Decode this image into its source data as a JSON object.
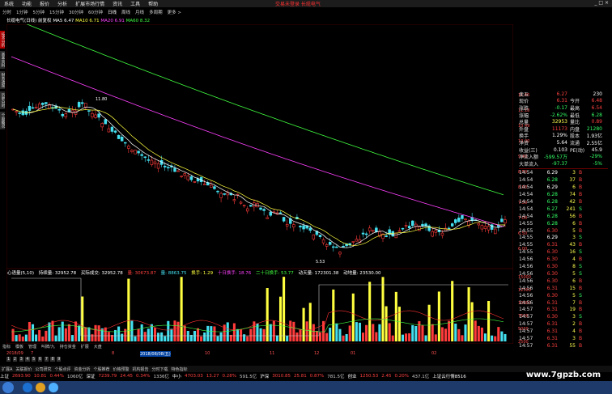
{
  "menu": [
    "系统",
    "功能",
    "报价",
    "分析",
    "扩展市场行情",
    "资讯",
    "工具",
    "帮助"
  ],
  "app_title": "交易未登录  长缆电气",
  "window_controls": "_ □ ×",
  "toolbar": [
    "分时",
    "1分钟",
    "5分钟",
    "15分钟",
    "30分钟",
    "60分钟",
    "日线",
    "周线",
    "月线",
    "多周期",
    "更多 >"
  ],
  "stock_header": {
    "name": "长缆电气(日线)",
    "mode": "前复权",
    "ma5": "MA5 6.47",
    "ma10": "MA10 6.71",
    "ma20": "MA20 6.91",
    "ma60": "MA60 8.32"
  },
  "sidebar_tabs": [
    "技术分析",
    "基本资料",
    "财务透视",
    "历史分时",
    "个股概况"
  ],
  "kline_annotations": {
    "high": "11.80",
    "low": "5.53"
  },
  "price_axis": [
    "11.65",
    "11.18",
    "10.49",
    "10.00",
    "9.40",
    "8.50",
    "8.00",
    "7.50",
    "7.00",
    "6.50",
    "6.00"
  ],
  "volume_header": {
    "indicator": "心语量(5,10)",
    "total": "持续量: 32952.78",
    "actual": "买际成交: 32952.78",
    "v1": "量: 30673.87",
    "v2": "量: 8863.75",
    "turnover1": "换手: 1.29",
    "turnover10": "十日换手: 18.76",
    "turnover20": "二十日换手: 53.77",
    "active": "动天量: 172301.38",
    "avg": "动地量: 23530.00"
  },
  "vol_axis": [
    "15000",
    "12500",
    "10000",
    "7500",
    "5000",
    "2500"
  ],
  "bottom_tabs": [
    "指标",
    "模板",
    "管理",
    "叫牌/九",
    "持仓资金",
    "扩展",
    "大盘"
  ],
  "date_axis": {
    "start": "2018/09",
    "highlight": "2018/08/08(五)",
    "labels": [
      "7",
      "8",
      "9",
      "10",
      "11",
      "12",
      "01",
      "02"
    ]
  },
  "scroll_pages": [
    "1",
    "2",
    "3",
    "4",
    "5",
    "6",
    "7",
    "8",
    "9"
  ],
  "fn_bar": [
    "扩展A",
    "关联报价",
    "公司研究",
    "个股点评",
    "资金分析",
    "个股推荐",
    "价格预警",
    "机构报告",
    "分时下载",
    "特色指标"
  ],
  "status_bar": [
    {
      "label": "上证",
      "value": "2693.90",
      "change": "10.81",
      "pct": "0.44%",
      "amount": "1060亿"
    },
    {
      "label": "深证",
      "value": "7239.79",
      "change": "24.45",
      "pct": "0.34%",
      "amount": "1336亿"
    },
    {
      "label": "中小",
      "value": "4703.03",
      "change": "13.27",
      "pct": "0.28%",
      "amount": "591.5亿"
    },
    {
      "label": "沪深",
      "value": "3010.85",
      "change": "25.81",
      "pct": "0.87%",
      "amount": "781.5亿"
    },
    {
      "label": "创业",
      "value": "1250.53",
      "change": "2.45",
      "pct": "0.20%",
      "amount": "437.1亿"
    }
  ],
  "status_extra": "上证云行情8516",
  "watermark": "www.7gpzb.com",
  "quote": {
    "top": [
      {
        "l": "卖五",
        "v": "6.27",
        "c": "red",
        "l2": "",
        "v2": "230",
        "c2": "white"
      },
      {
        "l": "现价",
        "v": "6.31",
        "c": "red",
        "l2": "今开",
        "v2": "6.48",
        "c2": "red"
      },
      {
        "l": "涨跌",
        "v": "-0.17",
        "c": "green",
        "l2": "最高",
        "v2": "6.54",
        "c2": "red"
      },
      {
        "l": "涨幅",
        "v": "-2.62%",
        "c": "green",
        "l2": "最低",
        "v2": "6.28",
        "c2": "green"
      },
      {
        "l": "总量",
        "v": "32953",
        "c": "yellow",
        "l2": "量比",
        "v2": "0.89",
        "c2": "red"
      },
      {
        "l": "外盘",
        "v": "11173",
        "c": "red",
        "l2": "内盘",
        "v2": "21280",
        "c2": "green"
      },
      {
        "l": "换手",
        "v": "1.29%",
        "c": "white",
        "l2": "股本",
        "v2": "1.93亿",
        "c2": "white"
      },
      {
        "l": "净资",
        "v": "5.64",
        "c": "white",
        "l2": "流通",
        "v2": "2.55亿",
        "c2": "white"
      },
      {
        "l": "收益(三)",
        "v": "0.103",
        "c": "white",
        "l2": "PE(动)",
        "v2": "45.9",
        "c2": "white"
      },
      {
        "l": "净流入额",
        "v": "-599.57万",
        "c": "green",
        "l2": "",
        "v2": "-29%",
        "c2": "green"
      },
      {
        "l": "大单流入",
        "v": "-97.37",
        "c": "green",
        "l2": "",
        "v2": "-5%",
        "c2": "green"
      }
    ],
    "ticks": [
      {
        "t": "14:54",
        "p": "6.29",
        "v": "3",
        "s": "B"
      },
      {
        "t": "14:54",
        "p": "6.28",
        "v": "37",
        "s": "B"
      },
      {
        "t": "14:54",
        "p": "6.29",
        "v": "6",
        "s": "B"
      },
      {
        "t": "14:54",
        "p": "6.28",
        "v": "74",
        "s": "B"
      },
      {
        "t": "14:54",
        "p": "6.28",
        "v": "42",
        "s": "B"
      },
      {
        "t": "14:54",
        "p": "6.27",
        "v": "241",
        "s": "S"
      },
      {
        "t": "14:54",
        "p": "6.28",
        "v": "56",
        "s": "B"
      },
      {
        "t": "14:55",
        "p": "6.28",
        "v": "6",
        "s": "B"
      },
      {
        "t": "14:55",
        "p": "6.30",
        "v": "5",
        "s": "B"
      },
      {
        "t": "14:55",
        "p": "6.29",
        "v": "3",
        "s": "S"
      },
      {
        "t": "14:55",
        "p": "6.31",
        "v": "43",
        "s": "B"
      },
      {
        "t": "14:55",
        "p": "6.30",
        "v": "16",
        "s": "S"
      },
      {
        "t": "14:56",
        "p": "6.30",
        "v": "4",
        "s": "B"
      },
      {
        "t": "14:56",
        "p": "6.30",
        "v": "8",
        "s": "S"
      },
      {
        "t": "14:56",
        "p": "6.30",
        "v": "5",
        "s": "S"
      },
      {
        "t": "14:56",
        "p": "6.30",
        "v": "6",
        "s": "B"
      },
      {
        "t": "14:56",
        "p": "6.31",
        "v": "15",
        "s": "B"
      },
      {
        "t": "14:56",
        "p": "6.30",
        "v": "5",
        "s": "S"
      },
      {
        "t": "14:56",
        "p": "6.31",
        "v": "7",
        "s": "B"
      },
      {
        "t": "14:57",
        "p": "6.31",
        "v": "19",
        "s": "B"
      },
      {
        "t": "14:57",
        "p": "6.30",
        "v": "3",
        "s": "S"
      },
      {
        "t": "14:57",
        "p": "6.31",
        "v": "2",
        "s": "B"
      },
      {
        "t": "14:57",
        "p": "6.31",
        "v": "4",
        "s": "B"
      },
      {
        "t": "14:57",
        "p": "6.31",
        "v": "3",
        "s": "B"
      },
      {
        "t": "14:57",
        "p": "6.31",
        "v": "55",
        "s": "B"
      }
    ]
  },
  "colors": {
    "up": "#ff3b3b",
    "down": "#44e0f0",
    "ma5": "#ffffff",
    "ma10": "#ffff40",
    "ma20": "#ff40ff",
    "ma60": "#40ff40",
    "vol_up": "#ffff40",
    "vol_down": "#44e0f0"
  }
}
